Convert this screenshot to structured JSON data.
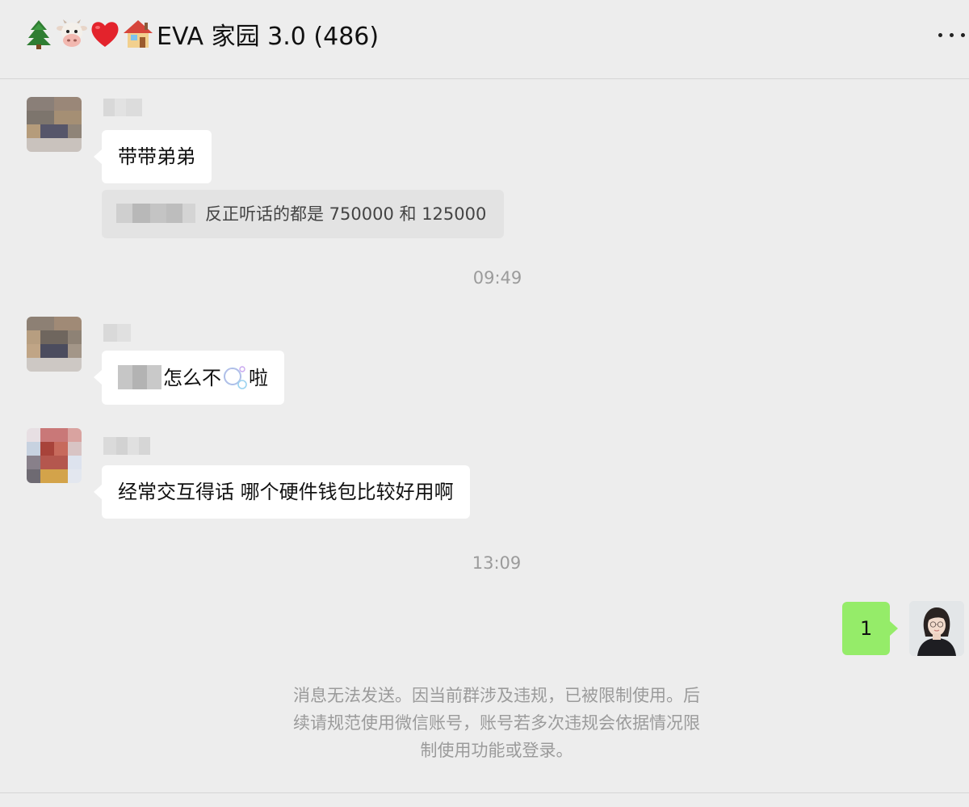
{
  "header": {
    "title": "EVA 家园 3.0 (486)",
    "emojis": [
      "tree-icon",
      "cow-icon",
      "heart-icon",
      "house-icon"
    ]
  },
  "messages": [
    {
      "sender": "group-member-1",
      "text": "带带弟弟",
      "quote": {
        "text": "反正听话的都是 750000 和 125000"
      }
    },
    {
      "sender": "group-member-2",
      "text": "怎么不",
      "text_after": "啦",
      "emoji": "bubbles-icon"
    },
    {
      "sender": "group-member-3",
      "text": "经常交互得话 哪个硬件钱包比较好用啊"
    },
    {
      "sender": "self",
      "text": "1"
    }
  ],
  "timestamps": [
    "09:49",
    "13:09"
  ],
  "system_notice": {
    "line1": "消息无法发送。因当前群涉及违规，已被限制使用。后",
    "line2": "续请规范使用微信账号，账号若多次违规会依据情况限",
    "line3": "制使用功能或登录。"
  },
  "colors": {
    "background": "#ededed",
    "self_bubble": "#95ec69",
    "other_bubble": "#ffffff",
    "quote_background": "#e3e3e3",
    "meta_text": "#9b9b9b"
  }
}
